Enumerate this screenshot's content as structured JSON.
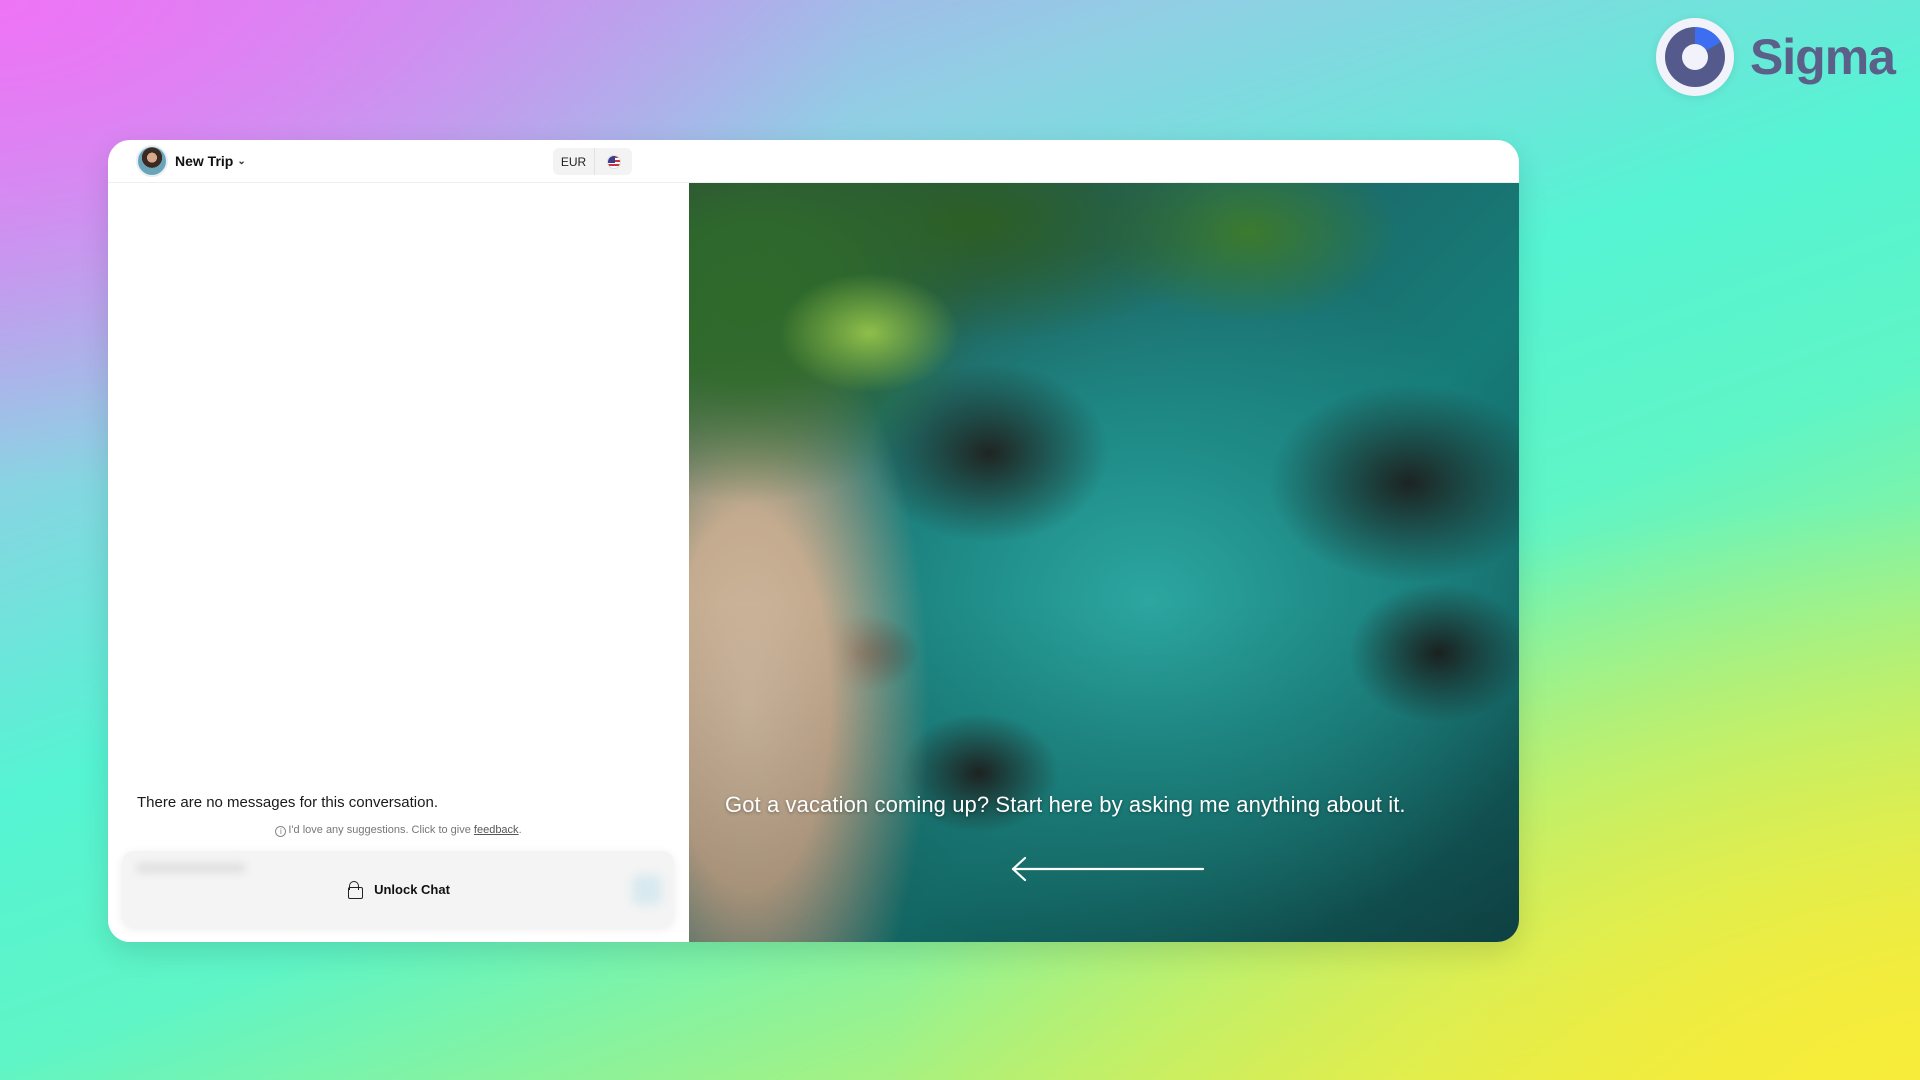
{
  "brand": {
    "name": "Sigma",
    "icon": "sigma-logo-icon"
  },
  "topbar": {
    "trip_title": "New Trip",
    "currency": "EUR",
    "flag_icon": "us-flag-icon"
  },
  "chat": {
    "empty_message": "There are no messages for this conversation.",
    "hint_prefix": "I'd love any suggestions. Click to give ",
    "hint_link": "feedback",
    "hint_suffix": ".",
    "unlock_label": "Unlock Chat"
  },
  "hero": {
    "prompt_text": "Got a vacation coming up? Start here by asking me anything about it."
  },
  "colors": {
    "brand_text": "#5a6088",
    "brand_accent": "#3d6df0"
  }
}
